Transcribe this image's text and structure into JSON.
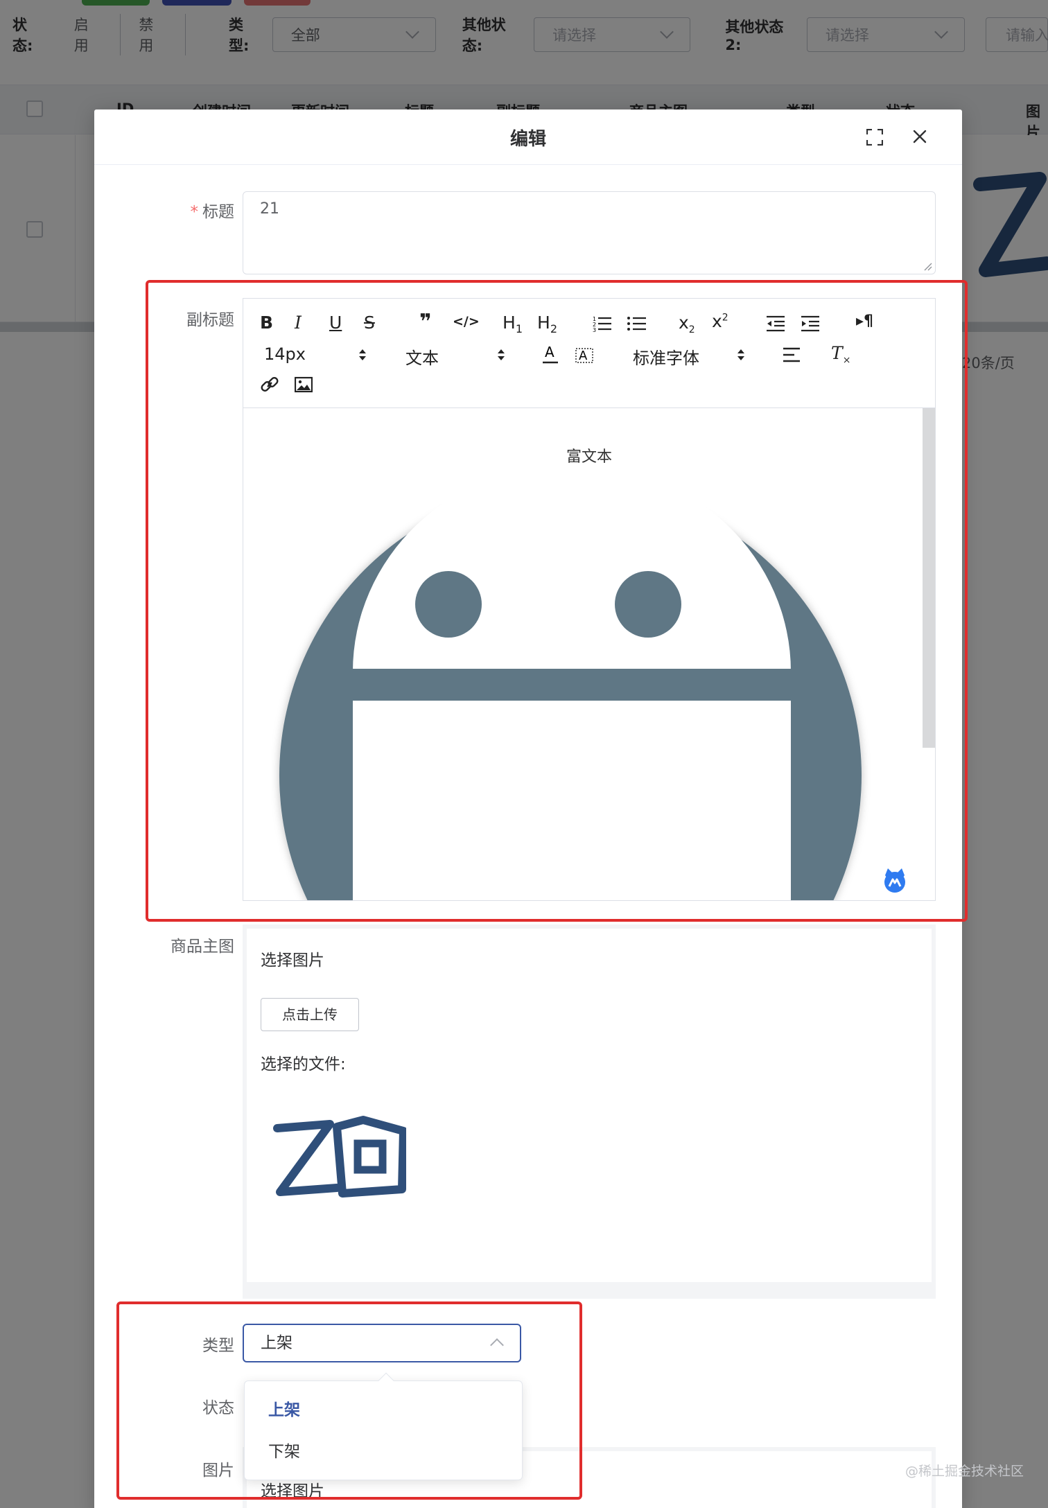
{
  "background": {
    "filter": {
      "status_label": "状态:",
      "status_options": [
        "启用",
        "禁用"
      ],
      "type_label": "类型:",
      "type_value": "全部",
      "other_status_label": "其他状态:",
      "other_status_placeholder": "请选择",
      "other_status2_label": "其他状态2:",
      "other_status2_placeholder": "请选择",
      "input_placeholder": "请输入"
    },
    "table_headers": [
      "ID",
      "创建时间",
      "更新时间",
      "标题",
      "副标题",
      "商品主图",
      "类型",
      "状态",
      "图片"
    ],
    "pager_size": "20条/页",
    "topbar_colors": [
      "#4caf50",
      "#3f51b5",
      "#e57373"
    ]
  },
  "dialog": {
    "title": "编辑",
    "fields": {
      "title_label": "标题",
      "title_value": "21",
      "subtitle_label": "副标题",
      "main_image_label": "商品主图",
      "type_label": "类型",
      "status_label": "状态",
      "image_label": "图片"
    },
    "editor": {
      "font_size": "14px",
      "block_format": "文本",
      "font_family": "标准字体",
      "content_text": "富文本"
    },
    "upload": {
      "choose_label": "选择图片",
      "button_label": "点击上传",
      "selected_label": "选择的文件:"
    },
    "type_select": {
      "value": "上架",
      "options": [
        "上架",
        "下架"
      ]
    },
    "image_field": {
      "choose_label": "选择图片"
    }
  },
  "watermark": "@稀土掘金技术社区",
  "colors": {
    "accent": "#3a58a5",
    "annotation": "#e02d2d",
    "avatar": "#5f7785",
    "logo": "#2f4f7a"
  }
}
